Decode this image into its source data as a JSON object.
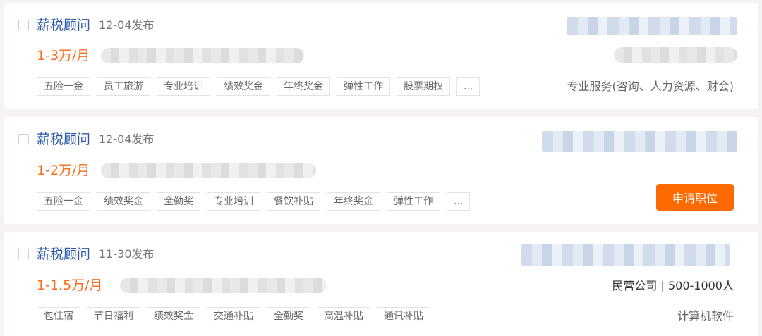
{
  "jobs": [
    {
      "title": "薪税顾问",
      "date": "12-04发布",
      "salary": "1-3万/月",
      "tags": [
        "五险一金",
        "员工旅游",
        "专业培训",
        "绩效奖金",
        "年终奖金",
        "弹性工作",
        "股票期权",
        "..."
      ],
      "industry": "专业服务(咨询、人力资源、财会)"
    },
    {
      "title": "薪税顾问",
      "date": "12-04发布",
      "salary": "1-2万/月",
      "tags": [
        "五险一金",
        "绩效奖金",
        "全勤奖",
        "专业培训",
        "餐饮补贴",
        "年终奖金",
        "弹性工作",
        "..."
      ],
      "apply_label": "申请职位"
    },
    {
      "title": "薪税顾问",
      "date": "11-30发布",
      "salary": "1-1.5万/月",
      "tags": [
        "包住宿",
        "节日福利",
        "绩效奖金",
        "交通补贴",
        "全勤奖",
        "高温补贴",
        "通讯补贴"
      ],
      "company_info": "民营公司 | 500-1000人",
      "industry": "计算机软件"
    }
  ],
  "colors": {
    "title": "#2b5aa8",
    "salary": "#ff6a1a",
    "button": "#ff6a00"
  },
  "icons": {
    "checkbox": "checkbox-icon"
  }
}
